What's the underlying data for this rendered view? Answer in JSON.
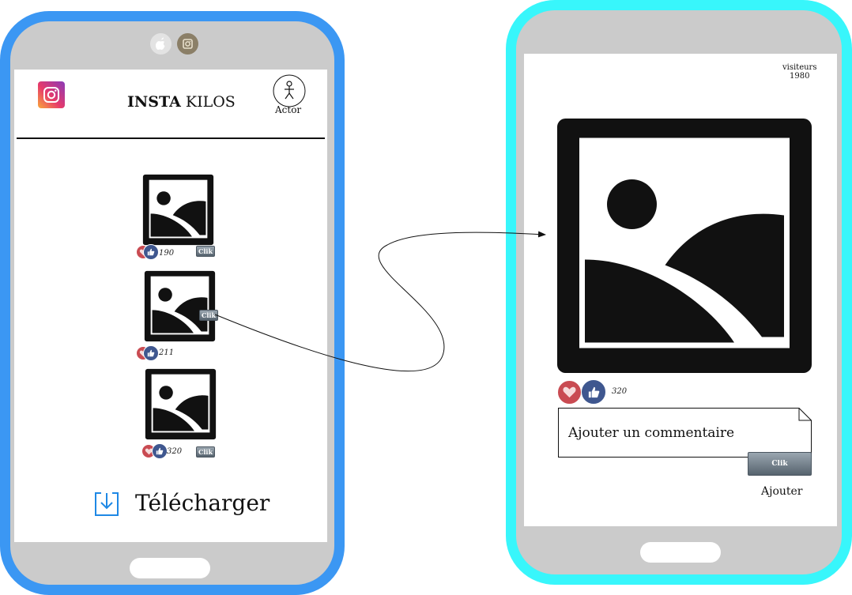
{
  "app": {
    "name_bold": "INSTA",
    "name_rest": "KILOS"
  },
  "profile": {
    "label": "Actor"
  },
  "feed": {
    "posts": [
      {
        "likes": "190",
        "button": "Clik"
      },
      {
        "likes": "211",
        "button": "Clik"
      },
      {
        "likes": "320",
        "button": "Clik"
      }
    ]
  },
  "download": {
    "label": "Télécharger"
  },
  "detail": {
    "visitors_label": "visiteurs",
    "visitors_count": "1980",
    "likes": "320",
    "comment_placeholder": "Ajouter un commentaire",
    "submit_button": "Clik",
    "submit_caption": "Ajouter"
  },
  "icons": {
    "logo": "instagram-logo-icon",
    "profile": "stick-figure-icon",
    "image": "image-placeholder-icon",
    "heart": "heart-icon",
    "like": "thumbs-up-icon",
    "download": "download-icon",
    "apple": "apple-icon",
    "camera": "camera-icon"
  },
  "colors": {
    "phone1_frame": "#3b97f3",
    "phone2_frame": "#38f6fb",
    "heart": "#c94b52",
    "like": "#3f578f",
    "download_icon": "#1e88e5"
  }
}
